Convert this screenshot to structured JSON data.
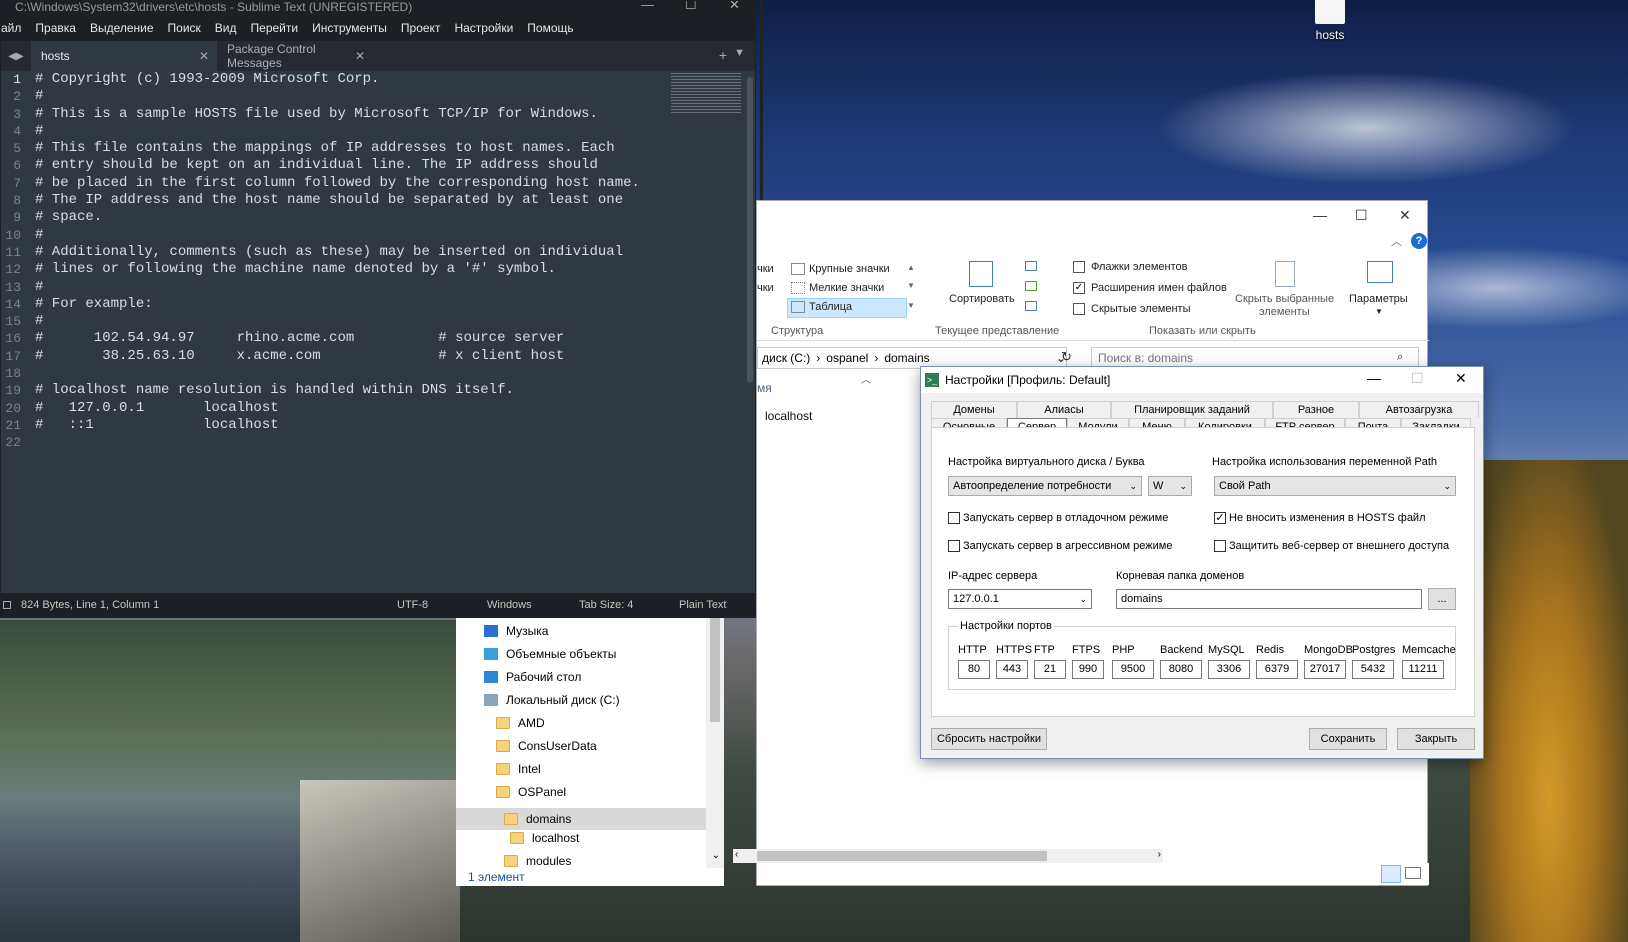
{
  "desktop": {
    "icon_label": "hosts"
  },
  "sublime": {
    "title": "C:\\Windows\\System32\\drivers\\etc\\hosts - Sublime Text (UNREGISTERED)",
    "menu": [
      "айл",
      "Правка",
      "Выделение",
      "Поиск",
      "Вид",
      "Перейти",
      "Инструменты",
      "Проект",
      "Настройки",
      "Помощь"
    ],
    "tabs": [
      {
        "label": "hosts"
      },
      {
        "label": "Package Control Messages"
      }
    ],
    "lines": [
      "# Copyright (c) 1993-2009 Microsoft Corp.",
      "#",
      "# This is a sample HOSTS file used by Microsoft TCP/IP for Windows.",
      "#",
      "# This file contains the mappings of IP addresses to host names. Each",
      "# entry should be kept on an individual line. The IP address should",
      "# be placed in the first column followed by the corresponding host name.",
      "# The IP address and the host name should be separated by at least one",
      "# space.",
      "#",
      "# Additionally, comments (such as these) may be inserted on individual",
      "# lines or following the machine name denoted by a '#' symbol.",
      "#",
      "# For example:",
      "#",
      "#      102.54.94.97     rhino.acme.com          # source server",
      "#       38.25.63.10     x.acme.com              # x client host",
      "",
      "# localhost name resolution is handled within DNS itself.",
      "#   127.0.0.1       localhost",
      "#   ::1             localhost",
      ""
    ],
    "status": {
      "info": "824 Bytes, Line 1, Column 1",
      "encoding": "UTF-8",
      "line_endings": "Windows",
      "tab_size": "Tab Size: 4",
      "syntax": "Plain Text"
    }
  },
  "explorer": {
    "ribbon": {
      "layout_partial_1": "чки",
      "layout_partial_2": "чки",
      "large_icons": "Крупные значки",
      "small_icons": "Мелкие значки",
      "table": "Таблица",
      "structure": "Структура",
      "sort": "Сортировать",
      "current_view": "Текущее представление",
      "item_checkboxes": "Флажки элементов",
      "extensions": "Расширения имен файлов",
      "hidden_items": "Скрытые элементы",
      "hide_selected_1": "Скрыть выбранные",
      "hide_selected_2": "элементы",
      "params": "Параметры",
      "show_hide": "Показать или скрыть"
    },
    "address": {
      "drive": "диск (C:)",
      "p1": "ospanel",
      "p2": "domains"
    },
    "search_placeholder": "Поиск в: domains",
    "col_partial": "мя",
    "files": [
      "localhost"
    ],
    "nav": [
      {
        "label": "Музыка"
      },
      {
        "label": "Объемные объекты"
      },
      {
        "label": "Рабочий стол"
      },
      {
        "label": "Локальный диск (C:)"
      },
      {
        "label": "AMD"
      },
      {
        "label": "ConsUserData"
      },
      {
        "label": "Intel"
      },
      {
        "label": "OSPanel"
      },
      {
        "label": "domains"
      },
      {
        "label": "localhost"
      },
      {
        "label": "modules"
      }
    ],
    "status": "1 элемент"
  },
  "dialog": {
    "title": "Настройки [Профиль: Default]",
    "tabs_row1": [
      "Домены",
      "Алиасы",
      "Планировщик заданий",
      "Разное",
      "Автозагрузка"
    ],
    "tabs_row2": [
      "Основные",
      "Сервер",
      "Модули",
      "Меню",
      "Кодировки",
      "FTP сервер",
      "Почта",
      "Закладки"
    ],
    "vdisk_label": "Настройка виртуального диска / Буква",
    "vdisk_value": "Автоопределение потребности",
    "vdisk_letter": "W",
    "path_label": "Настройка использования переменной Path",
    "path_value": "Свой Path",
    "chk_debug": "Запускать сервер в отладочном режиме",
    "chk_aggressive": "Запускать сервер в агрессивном режиме",
    "chk_hosts": "Не вносить изменения в HOSTS файл",
    "chk_protect": "Защитить веб-сервер от внешнего доступа",
    "ip_label": "IP-адрес сервера",
    "ip_value": "127.0.0.1",
    "root_label": "Корневая папка доменов",
    "root_value": "domains",
    "browse": "...",
    "ports_label": "Настройки портов",
    "ports": [
      {
        "name": "HTTP",
        "value": "80"
      },
      {
        "name": "HTTPS",
        "value": "443"
      },
      {
        "name": "FTP",
        "value": "21"
      },
      {
        "name": "FTPS",
        "value": "990"
      },
      {
        "name": "PHP",
        "value": "9500"
      },
      {
        "name": "Backend",
        "value": "8080"
      },
      {
        "name": "MySQL",
        "value": "3306"
      },
      {
        "name": "Redis",
        "value": "6379"
      },
      {
        "name": "MongoDB",
        "value": "27017"
      },
      {
        "name": "Postgres",
        "value": "5432"
      },
      {
        "name": "Memcache",
        "value": "11211"
      }
    ],
    "reset": "Сбросить настройки",
    "save": "Сохранить",
    "close": "Закрыть"
  }
}
